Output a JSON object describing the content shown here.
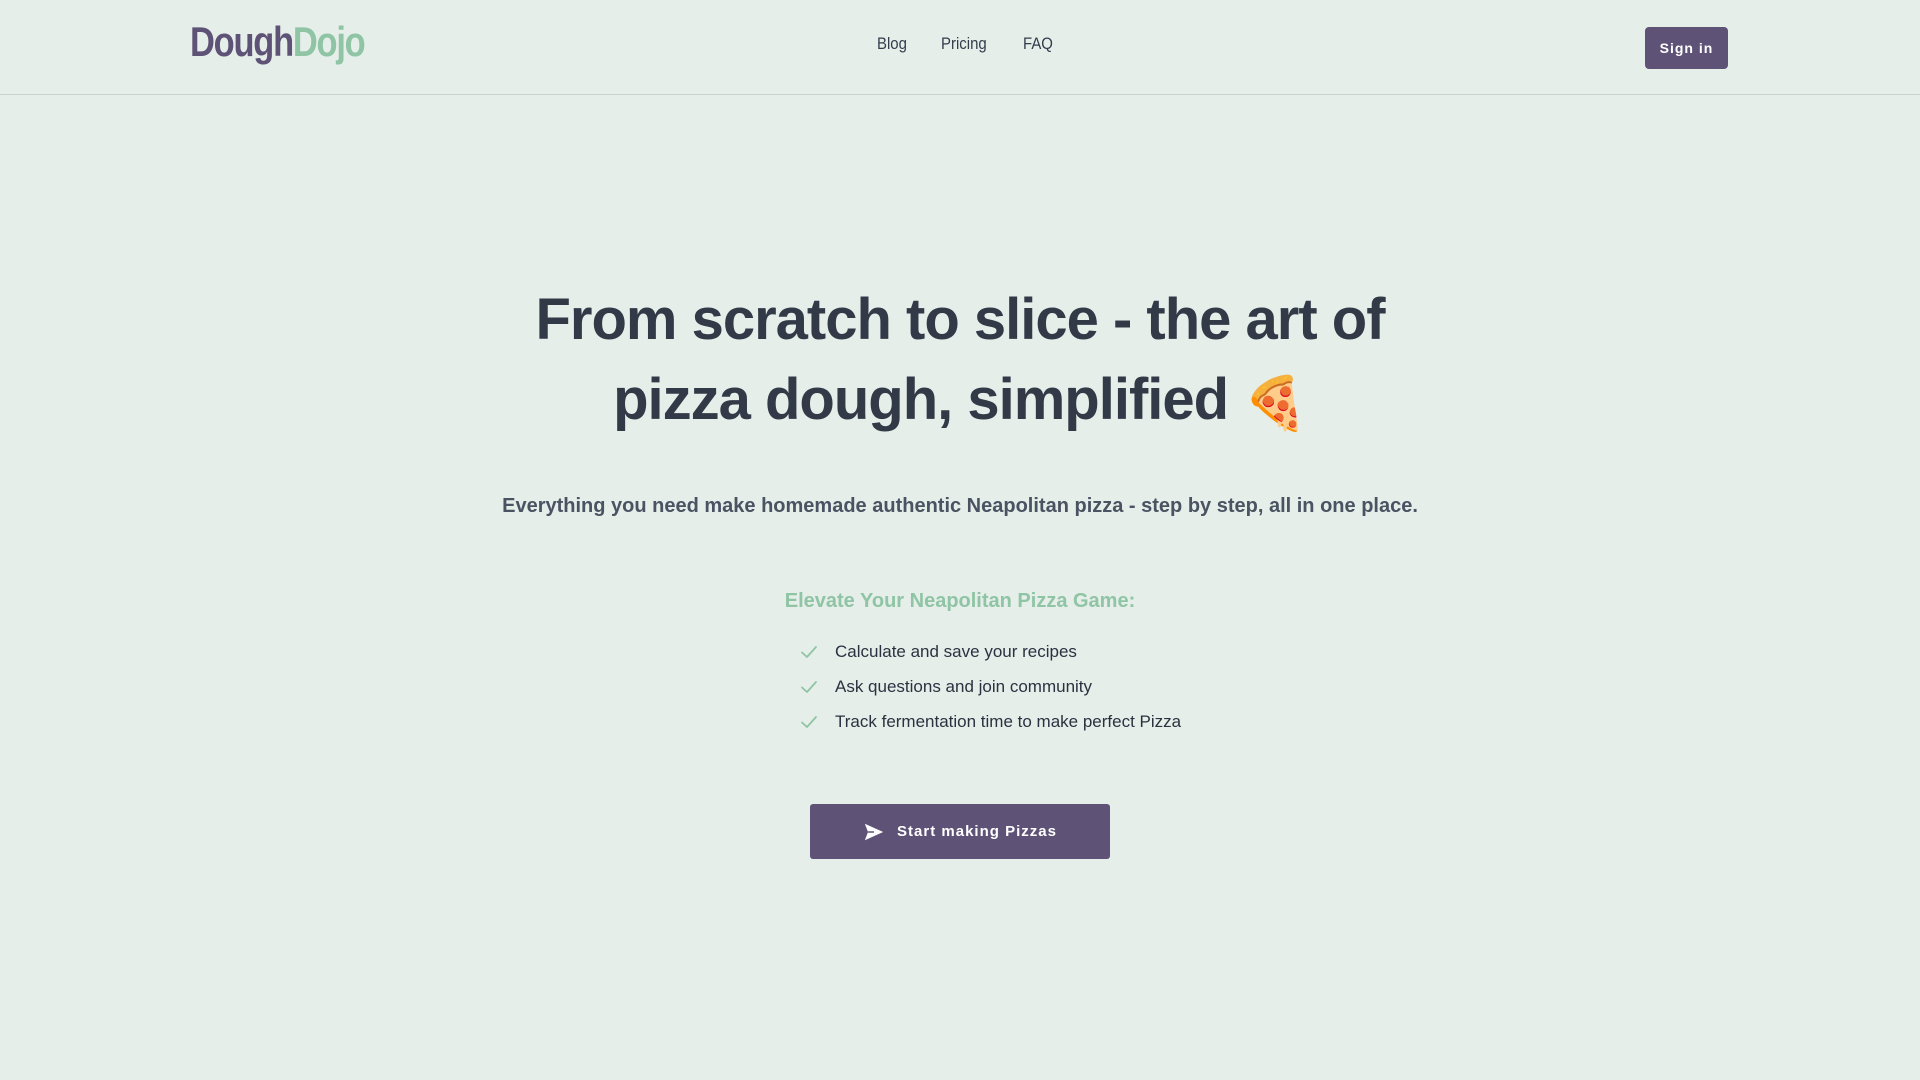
{
  "header": {
    "logo": {
      "part1": "Dough",
      "part2": "Dojo"
    },
    "nav": [
      {
        "label": "Blog"
      },
      {
        "label": "Pricing"
      },
      {
        "label": "FAQ"
      }
    ],
    "signin_label": "Sign in"
  },
  "hero": {
    "headline": "From scratch to slice - the art of pizza dough, simplified",
    "headline_emoji": "🍕",
    "subhead": "Everything you need make homemade authentic Neapolitan pizza - step by step, all in one place.",
    "features_title": "Elevate Your Neapolitan Pizza Game:",
    "features": [
      "Calculate and save your recipes",
      "Ask questions and join community",
      "Track fermentation time to make perfect Pizza"
    ],
    "cta_label": "Start making Pizzas"
  },
  "colors": {
    "background": "#e5eee9",
    "brand_purple": "#5e5377",
    "brand_green": "#8fc4a4",
    "text_dark": "#323a48"
  },
  "icons": {
    "feature_bullet": "check-icon",
    "cta": "send-icon"
  }
}
